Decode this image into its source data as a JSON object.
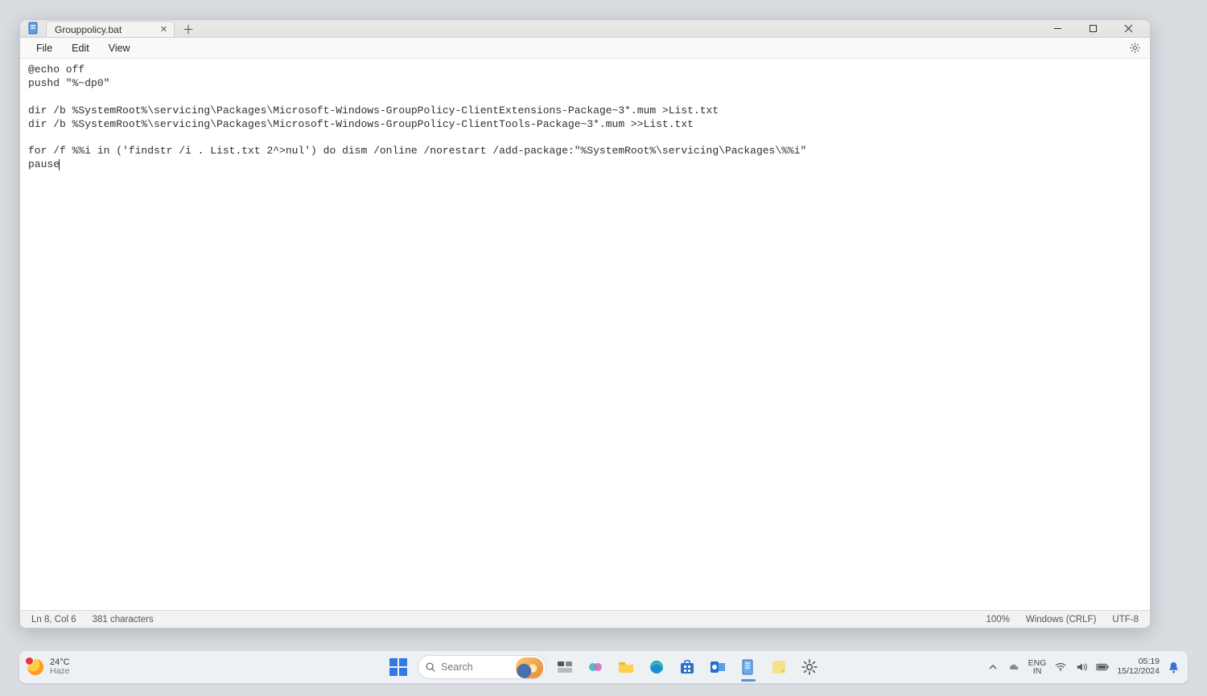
{
  "window": {
    "tab_title": "Grouppolicy.bat"
  },
  "menu": {
    "file": "File",
    "edit": "Edit",
    "view": "View"
  },
  "editor": {
    "content": "@echo off\npushd \"%~dp0\"\n\ndir /b %SystemRoot%\\servicing\\Packages\\Microsoft-Windows-GroupPolicy-ClientExtensions-Package~3*.mum >List.txt\ndir /b %SystemRoot%\\servicing\\Packages\\Microsoft-Windows-GroupPolicy-ClientTools-Package~3*.mum >>List.txt\n\nfor /f %%i in ('findstr /i . List.txt 2^>nul') do dism /online /norestart /add-package:\"%SystemRoot%\\servicing\\Packages\\%%i\"\npause"
  },
  "status": {
    "position": "Ln 8, Col 6",
    "chars": "381 characters",
    "zoom": "100%",
    "lineend": "Windows (CRLF)",
    "encoding": "UTF-8"
  },
  "taskbar": {
    "weather_temp": "24°C",
    "weather_desc": "Haze",
    "search_placeholder": "Search",
    "lang_top": "ENG",
    "lang_bottom": "IN",
    "time": "05:19",
    "date": "15/12/2024"
  }
}
